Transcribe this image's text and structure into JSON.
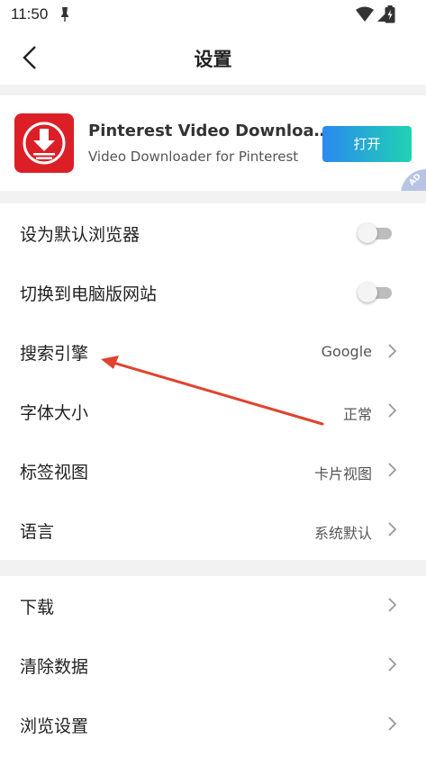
{
  "status": {
    "time": "11:50"
  },
  "header": {
    "title": "设置"
  },
  "ad": {
    "app_name": "Pinterest Video Downloa…",
    "subtitle": "Video Downloader for Pinterest",
    "open_label": "打开",
    "badge": "AD",
    "colors": {
      "icon_bg": "#dc1f26",
      "button_from": "#2b89f0",
      "button_to": "#1fd2b1"
    }
  },
  "settings": {
    "default_browser": {
      "label": "设为默认浏览器",
      "on": false
    },
    "desktop_site": {
      "label": "切换到电脑版网站",
      "on": false
    },
    "search_engine": {
      "label": "搜索引擎",
      "value": "Google"
    },
    "font_size": {
      "label": "字体大小",
      "value": "正常"
    },
    "tab_view": {
      "label": "标签视图",
      "value": "卡片视图"
    },
    "language": {
      "label": "语言",
      "value": "系统默认"
    },
    "download": {
      "label": "下载"
    },
    "clear_data": {
      "label": "清除数据"
    },
    "browse_settings": {
      "label": "浏览设置"
    }
  },
  "annotation": {
    "color": "#e0432e",
    "points_to": "search-engine"
  }
}
